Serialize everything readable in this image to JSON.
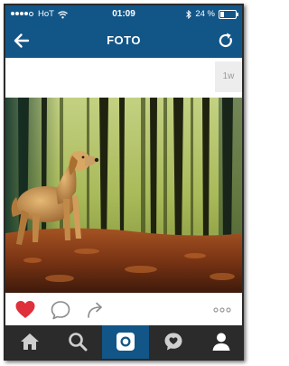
{
  "status_bar": {
    "carrier": "HoT",
    "time": "01:09",
    "battery_percent": "24 %",
    "battery_level": 0.24
  },
  "header": {
    "title": "FOTO",
    "back_icon": "back-arrow-icon",
    "refresh_icon": "refresh-icon"
  },
  "post": {
    "time_ago": "1w"
  },
  "actions": {
    "like_icon": "heart-icon",
    "liked": true,
    "comment_icon": "comment-bubble-icon",
    "share_icon": "share-arrow-icon",
    "more_icon": "more-dots-icon"
  },
  "tabbar": {
    "items": [
      "home-icon",
      "search-icon",
      "camera-icon",
      "activity-icon",
      "profile-icon"
    ],
    "active_index": 2
  },
  "colors": {
    "brand": "#125688",
    "like": "#e0303c",
    "tabbar": "#2b2b2b"
  }
}
